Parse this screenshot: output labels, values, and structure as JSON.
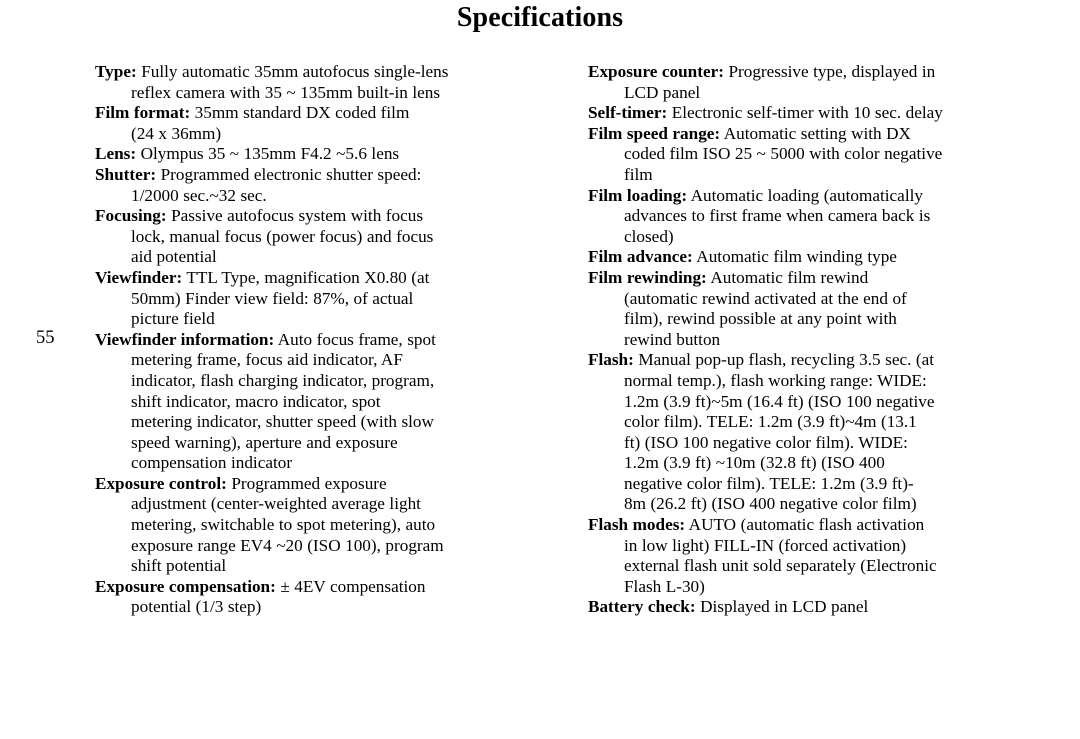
{
  "page": {
    "title": "Specifications",
    "folio": "55"
  },
  "left_column": [
    {
      "term": "Type:",
      "value": " Fully automatic 35mm autofocus single-lens\nreflex camera with 35 ~ 135mm built-in lens"
    },
    {
      "term": "Film format:",
      "value": " 35mm standard DX coded film\n(24 x 36mm)"
    },
    {
      "term": "Lens:",
      "value": " Olympus 35 ~ 135mm F4.2 ~5.6 lens"
    },
    {
      "term": "Shutter:",
      "value": " Programmed electronic shutter speed:\n1/2000 sec.~32 sec."
    },
    {
      "term": "Focusing:",
      "value": " Passive autofocus system with focus\nlock, manual focus (power focus) and focus\naid potential"
    },
    {
      "term": "Viewfinder:",
      "value": " TTL Type, magnification X0.80 (at\n50mm) Finder view field: 87%, of actual\npicture field"
    },
    {
      "term": "Viewfinder information:",
      "value": " Auto focus frame, spot\nmetering frame, focus aid indicator, AF\nindicator, flash charging indicator, program,\nshift indicator, macro indicator, spot\nmetering indicator, shutter speed (with slow\nspeed warning), aperture and exposure\ncompensation indicator"
    },
    {
      "term": "Exposure control:",
      "value": " Programmed exposure\nadjustment (center-weighted average light\nmetering, switchable to spot metering), auto\nexposure range EV4 ~20 (ISO 100), program\nshift potential"
    },
    {
      "term": "Exposure compensation:",
      "value": " ± 4EV compensation\npotential (1/3 step)"
    }
  ],
  "right_column": [
    {
      "term": "Exposure counter:",
      "value": " Progressive type, displayed in\nLCD panel"
    },
    {
      "term": "Self-timer:",
      "value": " Electronic self-timer with 10 sec. delay"
    },
    {
      "term": "Film speed range:",
      "value": " Automatic setting with DX\ncoded film ISO 25 ~ 5000 with color negative\nfilm"
    },
    {
      "term": "Film loading:",
      "value": " Automatic loading (automatically\nadvances to first frame when camera back is\nclosed)"
    },
    {
      "term": "Film advance:",
      "value": " Automatic film winding type"
    },
    {
      "term": "Film rewinding:",
      "value": " Automatic film rewind\n(automatic rewind activated at the end of\nfilm), rewind possible at any point with\nrewind button"
    },
    {
      "term": "Flash:",
      "value": " Manual pop-up flash, recycling 3.5 sec. (at\nnormal temp.), flash working range: WIDE:\n1.2m (3.9 ft)~5m (16.4 ft) (ISO 100 negative\ncolor film). TELE: 1.2m (3.9 ft)~4m (13.1\nft) (ISO 100 negative color film). WIDE:\n1.2m (3.9 ft) ~10m (32.8 ft) (ISO 400\nnegative color film). TELE: 1.2m (3.9 ft)-\n8m (26.2 ft) (ISO 400 negative color film)"
    },
    {
      "term": "Flash modes:",
      "value": " AUTO (automatic flash activation\nin low light) FILL-IN (forced activation)\nexternal flash unit sold separately (Electronic\nFlash L-30)"
    },
    {
      "term": "Battery check:",
      "value": " Displayed in LCD panel"
    }
  ]
}
